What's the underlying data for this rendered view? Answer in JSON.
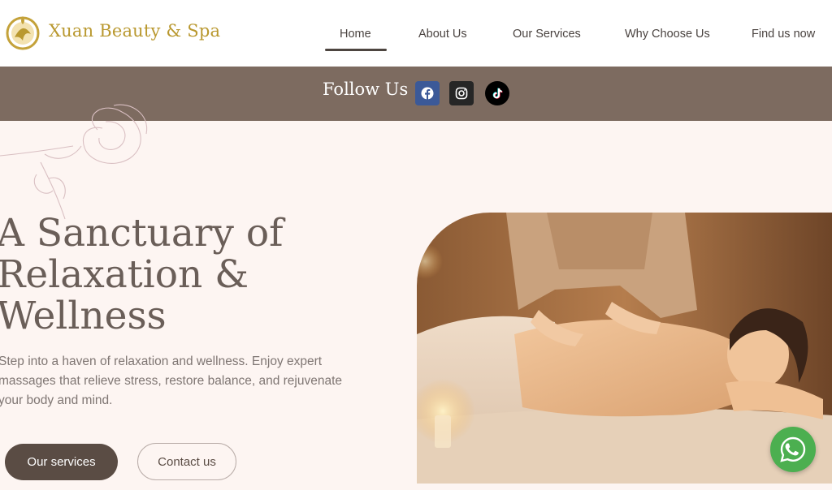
{
  "header": {
    "brand": "Xuan Beauty & Spa",
    "nav": [
      {
        "label": "Home",
        "active": true
      },
      {
        "label": "About Us"
      },
      {
        "label": "Our Services"
      },
      {
        "label": "Why Choose Us"
      },
      {
        "label": "Find us now"
      }
    ]
  },
  "follow": {
    "label": "Follow Us",
    "icons": [
      "facebook-icon",
      "instagram-icon",
      "tiktok-icon"
    ]
  },
  "hero": {
    "title_line1": "A Sanctuary of",
    "title_line2": "Relaxation &",
    "title_line3": "Wellness",
    "text": "Step into a haven of relaxation and wellness. Enjoy expert massages that relieve stress, restore balance, and rejuvenate your body and mind.",
    "primary_button": "Our services",
    "secondary_button": "Contact us"
  },
  "floating": {
    "icon": "whatsapp-icon"
  },
  "colors": {
    "brand_gold": "#b9982f",
    "follow_bar": "#7d6b60",
    "hero_bg": "#fdf5f2",
    "primary_button": "#5a4c44",
    "whatsapp": "#4caf50"
  }
}
